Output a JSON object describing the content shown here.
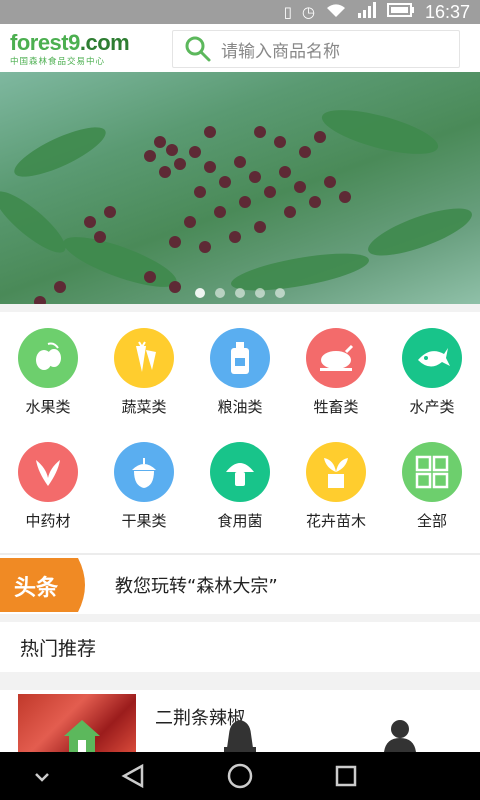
{
  "status_bar": {
    "time": "16:37",
    "icons": [
      "vibrate-icon",
      "alarm-icon",
      "wifi-icon",
      "signal-icon",
      "battery-icon"
    ]
  },
  "header": {
    "logo_text": "forest9",
    "logo_domain": ".com",
    "logo_subtitle": "中国森林食品交易中心",
    "search_placeholder": "请输入商品名称"
  },
  "banner": {
    "slide_count": 5,
    "active_index": 0
  },
  "categories": [
    {
      "label": "水果类",
      "icon": "fruit-icon",
      "color": "#6dcf6d"
    },
    {
      "label": "蔬菜类",
      "icon": "vegetable-icon",
      "color": "#ffcd2e"
    },
    {
      "label": "粮油类",
      "icon": "oil-bottle-icon",
      "color": "#5aaef0"
    },
    {
      "label": "牲畜类",
      "icon": "roast-chicken-icon",
      "color": "#f36b6b"
    },
    {
      "label": "水产类",
      "icon": "fish-icon",
      "color": "#18c48a"
    },
    {
      "label": "中药材",
      "icon": "herb-icon",
      "color": "#f36b6b"
    },
    {
      "label": "干果类",
      "icon": "acorn-icon",
      "color": "#5aaef0"
    },
    {
      "label": "食用菌",
      "icon": "mushroom-icon",
      "color": "#18c48a"
    },
    {
      "label": "花卉苗木",
      "icon": "seedling-icon",
      "color": "#ffcd2e"
    },
    {
      "label": "全部",
      "icon": "grid-icon",
      "color": "#6dcf6d"
    }
  ],
  "headline": {
    "badge": "头条",
    "text": "教您玩转“森林大宗”"
  },
  "hot": {
    "title": "热门推荐"
  },
  "product": {
    "name": "二荆条辣椒"
  },
  "tabs": [
    {
      "icon": "home-icon",
      "active": true
    },
    {
      "icon": "bell-icon",
      "active": false
    },
    {
      "icon": "user-icon",
      "active": false
    }
  ],
  "colors": {
    "accent": "#4caf50",
    "badge": "#f08a24",
    "tab_active": "#5cb85c"
  }
}
